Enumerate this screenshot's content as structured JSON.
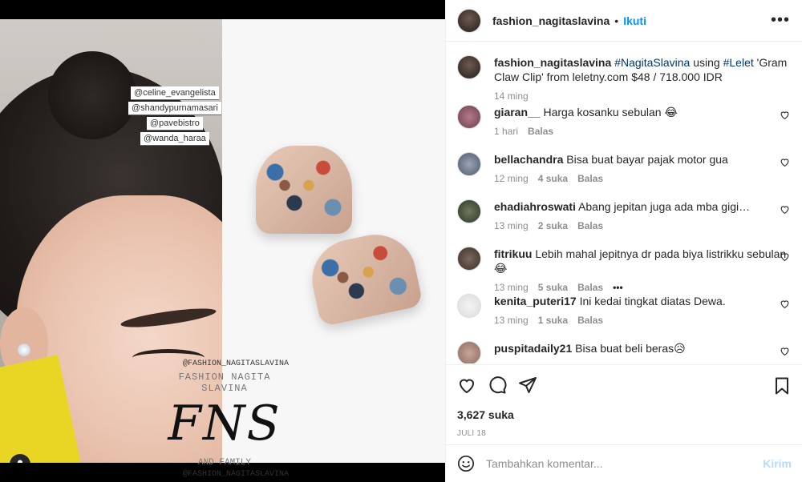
{
  "media": {
    "tags": [
      "@celine_evangelista",
      "@shandypurnamasari",
      "@pavebistro",
      "@wanda_haraa"
    ],
    "watermark": {
      "handle_top": "@FASHION_NAGITASLAVINA",
      "name": "FASHION NAGITA SLAVINA",
      "big": "FNS",
      "family": "AND FAMILY",
      "handle_bottom": "@FASHION_NAGITASLAVINA"
    }
  },
  "header": {
    "username": "fashion_nagitaslavina",
    "dot": "•",
    "follow": "Ikuti",
    "more": "•••"
  },
  "caption": {
    "username": "fashion_nagitaslavina",
    "hashtag1": "#NagitaSlavina",
    "mid1": "using",
    "hashtag2": "#Lelet",
    "rest": "'Gram Claw Clip' from leletny.com $48 / 718.000 IDR",
    "time": "14 ming"
  },
  "comments": [
    {
      "user": "giaran__",
      "text": "Harga kosanku sebulan 😂",
      "time": "1 hari",
      "likes": "",
      "reply": "Balas"
    },
    {
      "user": "bellachandra",
      "text": "Bisa buat bayar pajak motor gua",
      "time": "12 ming",
      "likes": "4 suka",
      "reply": "Balas"
    },
    {
      "user": "ehadiahroswati",
      "text": "Abang jepitan juga ada mba gigi…",
      "time": "13 ming",
      "likes": "2 suka",
      "reply": "Balas"
    },
    {
      "user": "fitrikuu",
      "text": "Lebih mahal jepitnya dr pada biya listrikku sebulan😂",
      "time": "13 ming",
      "likes": "5 suka",
      "reply": "Balas",
      "more": "•••"
    },
    {
      "user": "kenita_puteri17",
      "text": "Ini kedai tingkat diatas Dewa.",
      "time": "13 ming",
      "likes": "1 suka",
      "reply": "Balas"
    },
    {
      "user": "puspitadaily21",
      "text": "Bisa buat beli beras😥",
      "time": "",
      "likes": "",
      "reply": ""
    }
  ],
  "actions": {
    "likes": "3,627 suka",
    "date": "JULI 18"
  },
  "add_comment": {
    "placeholder": "Tambahkan komentar...",
    "post": "Kirim"
  },
  "colors": {
    "accent": "#0095f6",
    "link": "#00376b",
    "muted": "#8e8e8e",
    "post_disabled": "#b3dbff"
  }
}
